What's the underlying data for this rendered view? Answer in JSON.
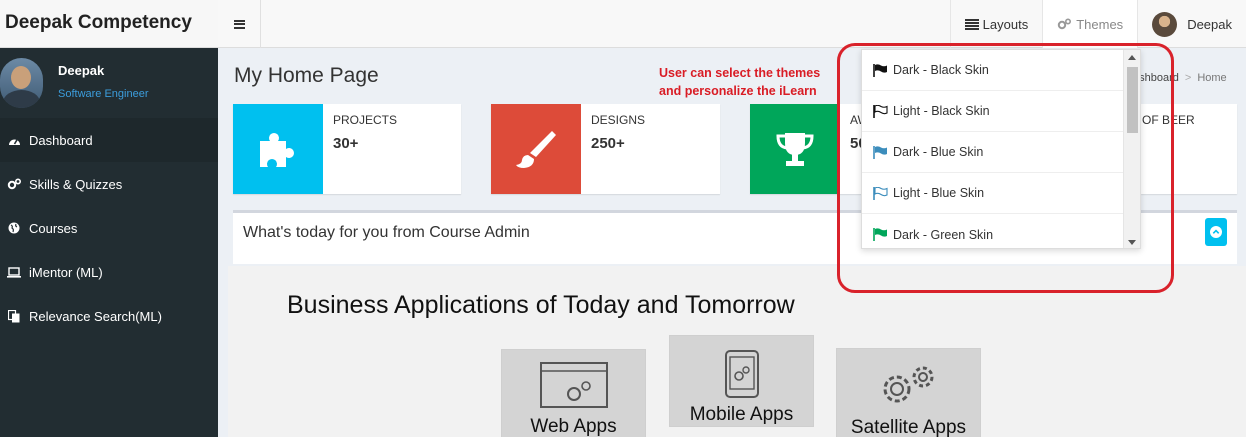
{
  "brand": "Deepak Competency",
  "topbar": {
    "layouts_label": "Layouts",
    "themes_label": "Themes",
    "user_label": "Deepak"
  },
  "sidebar": {
    "user_name": "Deepak",
    "user_role": "Software Engineer",
    "items": [
      {
        "label": "Dashboard",
        "icon": "dashboard-icon"
      },
      {
        "label": "Skills & Quizzes",
        "icon": "cogs-icon"
      },
      {
        "label": "Courses",
        "icon": "globe-icon"
      },
      {
        "label": "iMentor (ML)",
        "icon": "laptop-icon"
      },
      {
        "label": "Relevance Search(ML)",
        "icon": "copy-icon"
      }
    ]
  },
  "page": {
    "title": "My Home Page",
    "breadcrumb_first": "ashboard",
    "breadcrumb_sep": ">",
    "breadcrumb_current": "Home",
    "annotation_line1": "User can select the themes",
    "annotation_line2": "and personalize the iLearn"
  },
  "info_boxes": [
    {
      "label": "PROJECTS",
      "value": "30+",
      "color": "#00c0ef",
      "icon": "puzzle-icon"
    },
    {
      "label": "DESIGNS",
      "value": "250+",
      "color": "#dd4b39",
      "icon": "paint-brush-icon"
    },
    {
      "label": "AW",
      "value": "50",
      "color": "#00a65a",
      "icon": "trophy-icon"
    },
    {
      "label": "OF BEER",
      "value": ""
    }
  ],
  "course_box": {
    "title": "What's today for you from Course Admin"
  },
  "banner": {
    "title": "Business Applications of Today and Tomorrow",
    "apps": [
      "Web Apps",
      "Mobile Apps",
      "Satellite Apps"
    ]
  },
  "themes_dropdown": {
    "items": [
      {
        "label": "Dark - Black Skin",
        "color": "#111111",
        "style": "solid"
      },
      {
        "label": "Light - Black Skin",
        "color": "#111111",
        "style": "outline"
      },
      {
        "label": "Dark - Blue Skin",
        "color": "#3c8dbc",
        "style": "solid"
      },
      {
        "label": "Light - Blue Skin",
        "color": "#3c8dbc",
        "style": "outline"
      },
      {
        "label": "Dark - Green Skin",
        "color": "#00a65a",
        "style": "solid"
      }
    ]
  }
}
